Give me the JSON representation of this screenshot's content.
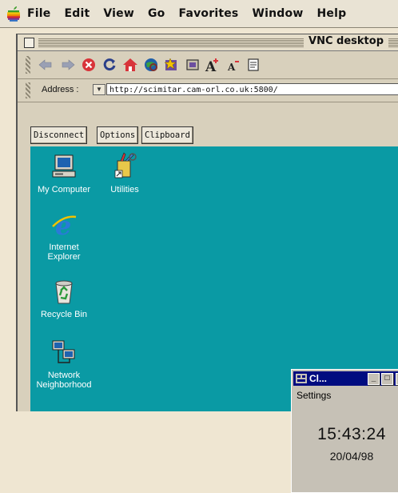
{
  "menubar": {
    "items": [
      "File",
      "Edit",
      "View",
      "Go",
      "Favorites",
      "Window",
      "Help"
    ]
  },
  "browser": {
    "title": "VNC desktop",
    "toolbar_icons": [
      "back-arrow-icon",
      "forward-arrow-icon",
      "stop-icon",
      "refresh-icon",
      "home-icon",
      "search-icon",
      "favorites-icon",
      "history-icon",
      "larger-text-icon",
      "smaller-text-icon",
      "print-icon"
    ],
    "address_label": "Address :",
    "address_value": "http://scimitar.cam-orl.co.uk:5800/"
  },
  "vnc": {
    "buttons": [
      "Disconnect",
      "Options",
      "Clipboard"
    ]
  },
  "desktop": {
    "background": "#0a9aa4",
    "icons": [
      {
        "name": "my-computer",
        "label": "My Computer"
      },
      {
        "name": "utilities",
        "label": "Utilities"
      },
      {
        "name": "internet-explorer",
        "label_line1": "Internet",
        "label_line2": "Explorer"
      },
      {
        "name": "recycle-bin",
        "label": "Recycle Bin"
      },
      {
        "name": "network-neighborhood",
        "label_line1": "Network",
        "label_line2": "Neighborhood"
      }
    ]
  },
  "clock": {
    "title": "Cl...",
    "menu": "Settings",
    "time": "15:43:24",
    "date": "20/04/98",
    "title_color": "#000c80"
  }
}
